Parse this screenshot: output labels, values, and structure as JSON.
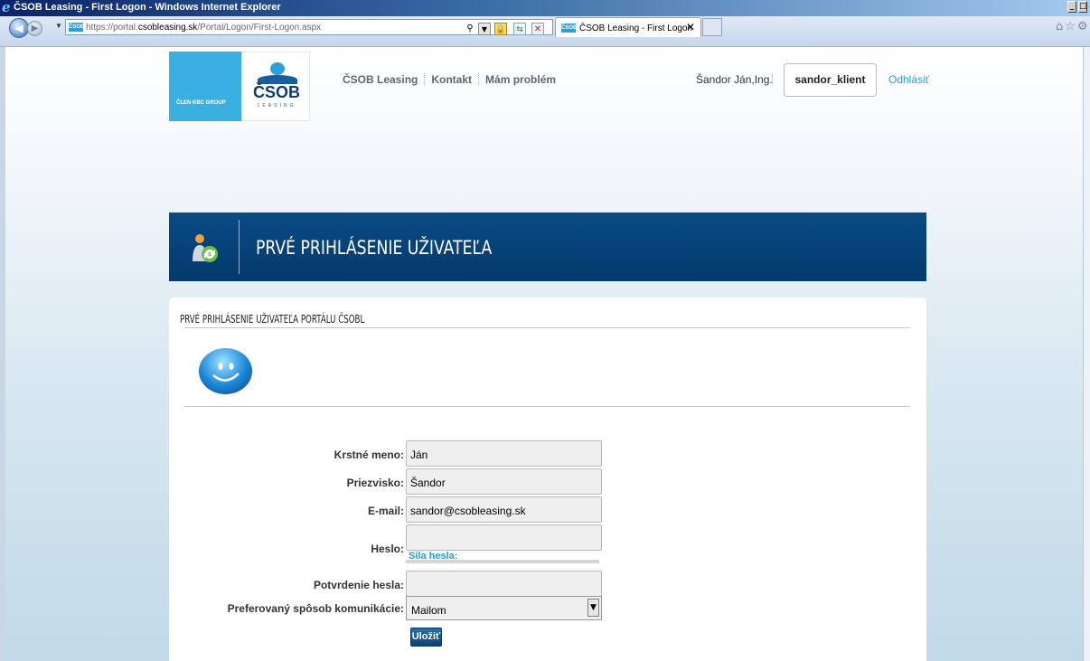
{
  "browser": {
    "window_title": "ČSOB Leasing - First Logon - Windows Internet Explorer",
    "url_prefix": "https://portal.",
    "url_domain": "csobleasing.sk",
    "url_path": "/Portal/Logon/First-Logon.aspx",
    "tab_label": "ČSOB Leasing - First Logon",
    "favicon_text": "ČSOB"
  },
  "site": {
    "kbc_label": "ČLEN KBC GROUP",
    "logo_word": "ČSOB",
    "logo_sub": "LEASING",
    "nav": [
      "ČSOB Leasing",
      "Kontakt",
      "Mám problém"
    ],
    "user_full_name": "Šandor Ján,Ing.",
    "username": "sandor_klient",
    "logout": "Odhlásiť"
  },
  "header": {
    "title": "PRVÉ PRIHLÁSENIE UŽIVATEĽA"
  },
  "form": {
    "subtitle": "PRVÉ PRIHLÁSENIE UŽIVATEĽA PORTÁLU ČSOBL",
    "fields": {
      "first_name": {
        "label": "Krstné meno:",
        "value": "Ján"
      },
      "last_name": {
        "label": "Priezvisko:",
        "value": "Šandor"
      },
      "email": {
        "label": "E-mail:",
        "value": "sandor@csobleasing.sk"
      },
      "password": {
        "label": "Heslo:",
        "value": ""
      },
      "password_confirm": {
        "label": "Potvrdenie hesla:",
        "value": ""
      },
      "communication": {
        "label": "Preferovaný spôsob komunikácie:",
        "value": "Mailom"
      }
    },
    "strength_label": "Sila hesla:",
    "save_label": "Uložiť"
  },
  "colors": {
    "header_blue": "#043a6c",
    "accent_cyan": "#2aa0d8",
    "kbc_blue": "#3ab0e2"
  }
}
